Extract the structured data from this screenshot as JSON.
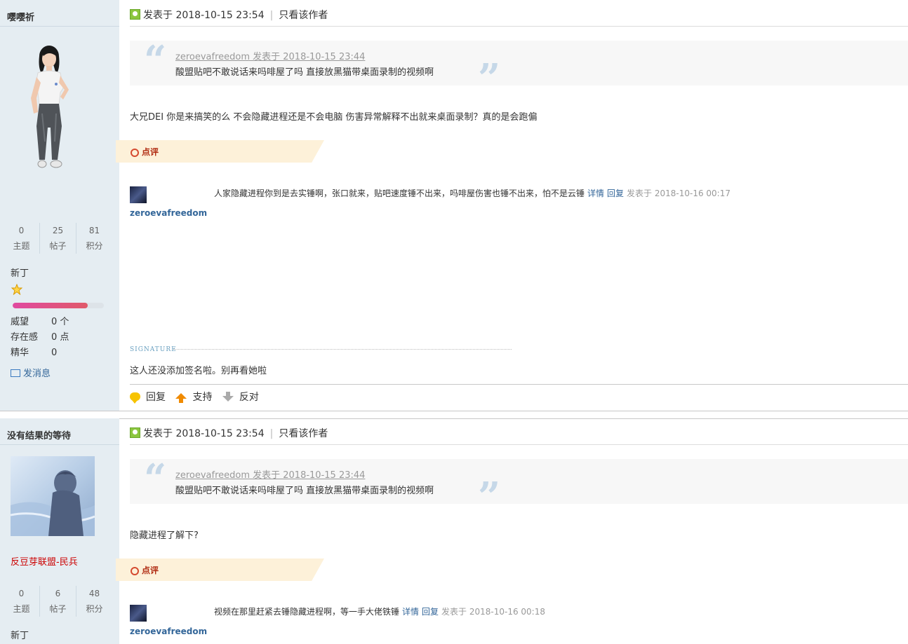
{
  "posts": [
    {
      "author": "嘤嘤祈",
      "stats": [
        {
          "value": "0",
          "label": "主题"
        },
        {
          "value": "25",
          "label": "帖子"
        },
        {
          "value": "81",
          "label": "积分"
        }
      ],
      "rank": "新丁",
      "progress": 0.82,
      "props": [
        {
          "key": "威望",
          "value": "0 个"
        },
        {
          "key": "存在感",
          "value": "0 点"
        },
        {
          "key": "精华",
          "value": "0"
        }
      ],
      "send_message": "发消息",
      "posted_at": "发表于 2018-10-15 23:54",
      "only_author": "只看该作者",
      "quote": {
        "meta": "zeroevafreedom 发表于 2018-10-15 23:44",
        "text": "酸盟贴吧不敢说话来吗啡屋了吗 直接放黑猫带桌面录制的视频啊"
      },
      "body": "大兄DEI  你是来搞笑的么  不会隐藏进程还是不会电脑  伤害异常解释不出就来桌面录制？真的是会跑偏",
      "review_label": "点评",
      "comment": {
        "user": "zeroevafreedom",
        "text": "人家隐藏进程你到是去实锤啊，张口就来，贴吧速度锤不出来，吗啡屋伤害也锤不出来，怕不是云锤",
        "detail": "详情",
        "reply": "回复",
        "time": "发表于 2018-10-16 00:17"
      },
      "signature_label": "SIGNATURE",
      "signature": "这人还没添加签名啦。别再看她啦",
      "actions": {
        "reply": "回复",
        "support": "支持",
        "oppose": "反对"
      }
    },
    {
      "author": "没有结果的等待",
      "medal": "反豆芽联盟-民兵",
      "stats": [
        {
          "value": "0",
          "label": "主题"
        },
        {
          "value": "6",
          "label": "帖子"
        },
        {
          "value": "48",
          "label": "积分"
        }
      ],
      "rank": "新丁",
      "posted_at": "发表于 2018-10-15 23:54",
      "only_author": "只看该作者",
      "quote": {
        "meta": "zeroevafreedom 发表于 2018-10-15 23:44",
        "text": "酸盟贴吧不敢说话来吗啡屋了吗 直接放黑猫带桌面录制的视频啊"
      },
      "body": "隐藏进程了解下?",
      "review_label": "点评",
      "comment": {
        "user": "zeroevafreedom",
        "text": "视频在那里赶紧去锤隐藏进程啊，等一手大佬铁锤",
        "detail": "详情",
        "reply": "回复",
        "time": "发表于 2018-10-16 00:18"
      }
    }
  ]
}
